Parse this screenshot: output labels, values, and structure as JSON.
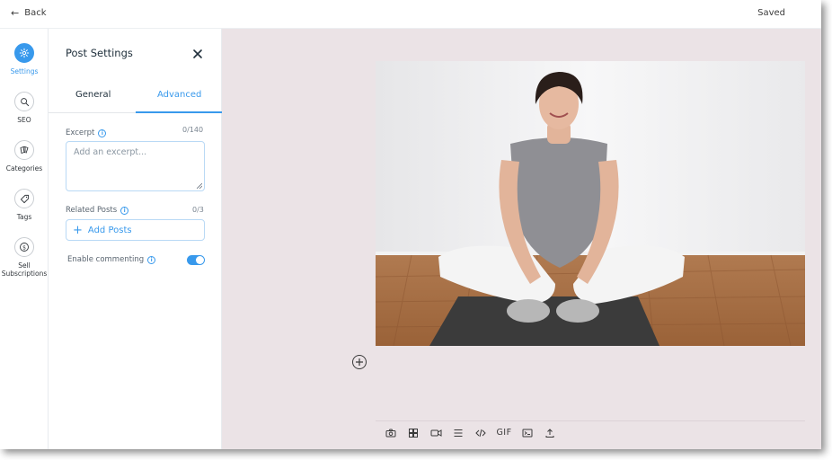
{
  "topbar": {
    "back_label": "Back",
    "status": "Saved"
  },
  "rail": {
    "items": [
      {
        "label": "Settings",
        "icon": "gear-icon",
        "active": true
      },
      {
        "label": "SEO",
        "icon": "search-icon"
      },
      {
        "label": "Categories",
        "icon": "categories-icon"
      },
      {
        "label": "Tags",
        "icon": "tag-icon"
      },
      {
        "label": "Sell\nSubscriptions",
        "icon": "dollar-icon"
      }
    ]
  },
  "panel": {
    "title": "Post Settings",
    "tabs": [
      {
        "label": "General"
      },
      {
        "label": "Advanced",
        "active": true
      }
    ],
    "excerpt": {
      "label": "Excerpt",
      "counter": "0/140",
      "value": "",
      "placeholder": "Add an excerpt..."
    },
    "related_posts": {
      "label": "Related Posts",
      "counter": "0/3",
      "button_label": "Add Posts"
    },
    "commenting": {
      "label": "Enable commenting",
      "enabled": true
    }
  },
  "toolbar": {
    "items": [
      "camera-icon",
      "gallery-icon",
      "video-icon",
      "divider-icon",
      "code-icon",
      "gif-icon",
      "embed-icon",
      "upload-icon"
    ],
    "gif_label": "GIF"
  },
  "colors": {
    "accent": "#3899ec",
    "canvas": "#ebe3e6"
  }
}
